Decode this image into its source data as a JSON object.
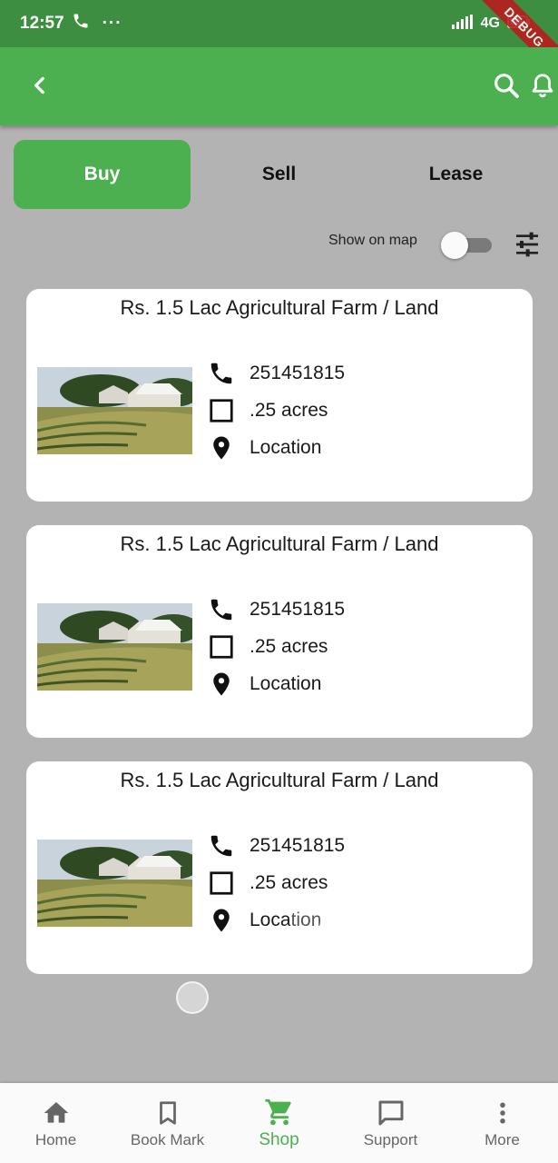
{
  "status_bar": {
    "time": "12:57",
    "dots": "···",
    "network": "4G",
    "debug_label": "DEBUG"
  },
  "colors": {
    "primary": "#4caf50",
    "status_bar": "#3e8e41",
    "background": "#b3b3b3",
    "nav_inactive": "#666666"
  },
  "app_bar": {
    "back_icon": "chevron-left-icon",
    "search_icon": "search-icon",
    "bell_icon": "bell-icon"
  },
  "tabs": [
    {
      "label": "Buy",
      "active": true
    },
    {
      "label": "Sell",
      "active": false
    },
    {
      "label": "Lease",
      "active": false
    }
  ],
  "map_toggle": {
    "label": "Show on map",
    "on": false
  },
  "listings": [
    {
      "title": "Rs. 1.5 Lac Agricultural Farm / Land",
      "phone": "251451815",
      "area": ".25 acres",
      "location": "Location"
    },
    {
      "title": "Rs. 1.5 Lac Agricultural Farm / Land",
      "phone": "251451815",
      "area": ".25 acres",
      "location": "Location"
    },
    {
      "title": "Rs. 1.5 Lac Agricultural Farm / Land",
      "phone": "251451815",
      "area": ".25 acres",
      "location": "Location"
    }
  ],
  "bottom_nav": [
    {
      "label": "Home",
      "icon": "home-icon",
      "active": false
    },
    {
      "label": "Book Mark",
      "icon": "bookmark-icon",
      "active": false
    },
    {
      "label": "Shop",
      "icon": "cart-icon",
      "active": true
    },
    {
      "label": "Support",
      "icon": "chat-icon",
      "active": false
    },
    {
      "label": "More",
      "icon": "more-vertical-icon",
      "active": false
    }
  ]
}
